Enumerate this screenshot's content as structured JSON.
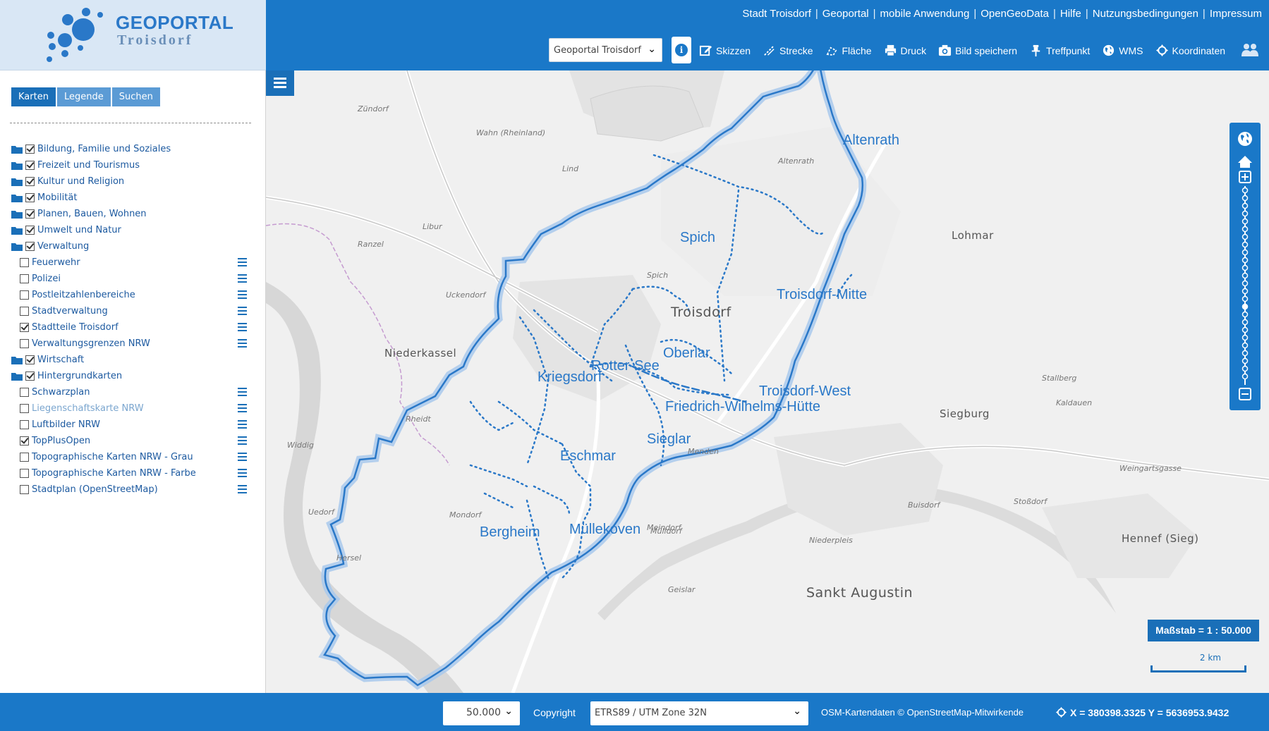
{
  "logo": {
    "title": "GEOPORTAL",
    "subtitle": "Troisdorf"
  },
  "top_links": [
    "Stadt Troisdorf",
    "Geoportal",
    "mobile Anwendung",
    "OpenGeoData",
    "Hilfe",
    "Nutzungsbedingungen",
    "Impressum"
  ],
  "portal_select": {
    "value": "Geoportal Troisdorf"
  },
  "tools": [
    {
      "label": "Skizzen",
      "icon": "pencil-icon"
    },
    {
      "label": "Strecke",
      "icon": "ruler-icon"
    },
    {
      "label": "Fläche",
      "icon": "area-icon"
    },
    {
      "label": "Druck",
      "icon": "print-icon"
    },
    {
      "label": "Bild speichern",
      "icon": "camera-icon"
    },
    {
      "label": "Treffpunkt",
      "icon": "pin-icon"
    },
    {
      "label": "WMS",
      "icon": "globe-icon"
    },
    {
      "label": "Koordinaten",
      "icon": "crosshair-icon"
    }
  ],
  "sidebar": {
    "tabs": [
      "Karten",
      "Legende",
      "Suchen"
    ],
    "active_tab": "Karten",
    "layers": [
      {
        "label": "Bildung, Familie und Soziales",
        "level": 0,
        "checked": true
      },
      {
        "label": "Freizeit und Tourismus",
        "level": 0,
        "checked": true
      },
      {
        "label": "Kultur und Religion",
        "level": 0,
        "checked": true
      },
      {
        "label": "Mobilität",
        "level": 0,
        "checked": true
      },
      {
        "label": "Planen, Bauen, Wohnen",
        "level": 0,
        "checked": true
      },
      {
        "label": "Umwelt und Natur",
        "level": 0,
        "checked": true
      },
      {
        "label": "Verwaltung",
        "level": 0,
        "checked": true
      },
      {
        "label": "Feuerwehr",
        "level": 1,
        "checked": false
      },
      {
        "label": "Polizei",
        "level": 1,
        "checked": false
      },
      {
        "label": "Postleitzahlenbereiche",
        "level": 1,
        "checked": false
      },
      {
        "label": "Stadtverwaltung",
        "level": 1,
        "checked": false
      },
      {
        "label": "Stadtteile Troisdorf",
        "level": 1,
        "checked": true
      },
      {
        "label": "Verwaltungsgrenzen NRW",
        "level": 1,
        "checked": false
      },
      {
        "label": "Wirtschaft",
        "level": 0,
        "checked": true
      },
      {
        "label": "Hintergrundkarten",
        "level": 0,
        "checked": true
      },
      {
        "label": "Schwarzplan",
        "level": 1,
        "checked": false
      },
      {
        "label": "Liegenschaftskarte NRW",
        "level": 1,
        "checked": false,
        "dim": true
      },
      {
        "label": "Luftbilder NRW",
        "level": 1,
        "checked": false
      },
      {
        "label": "TopPlusOpen",
        "level": 1,
        "checked": true
      },
      {
        "label": "Topographische Karten NRW - Grau",
        "level": 1,
        "checked": false
      },
      {
        "label": "Topographische Karten NRW - Farbe",
        "level": 1,
        "checked": false
      },
      {
        "label": "Stadtplan (OpenStreetMap)",
        "level": 1,
        "checked": false
      }
    ]
  },
  "map": {
    "district_labels": [
      "Altenrath",
      "Spich",
      "Troisdorf-Mitte",
      "Oberlar",
      "Rotter-See",
      "Kriegsdorf",
      "Troisdorf-West",
      "Friedrich-Wilhelms-Hütte",
      "Sieglar",
      "Eschmar",
      "Bergheim",
      "Müllekoven"
    ],
    "place_labels": [
      "Troisdorf",
      "Niederkassel",
      "Lohmar",
      "Siegburg",
      "Sankt Augustin",
      "Hennef (Sieg)"
    ],
    "small_labels": [
      "Zündorf",
      "Wahn (Rheinland)",
      "Lind",
      "Libur",
      "Ranzel",
      "Uckendorf",
      "Rheidt",
      "Mondorf",
      "Menden",
      "Mülldorf",
      "Stallberg",
      "Kaldauen",
      "Hersel",
      "Widdig",
      "Uedorf",
      "Stoßdorf",
      "Buisdorf",
      "Niederpleis",
      "Geislar",
      "Weingartsgasse",
      "Meindorf",
      "Altenrath",
      "Spich"
    ],
    "scale_text": "Maßstab = 1 : 50.000",
    "scalebar_label": "2 km",
    "boundary_color": "#2a78c8"
  },
  "footer": {
    "scale_value": "50.000",
    "copyright_label": "Copyright",
    "crs_value": "ETRS89 / UTM Zone 32N",
    "attribution": "OSM-Kartendaten © OpenStreetMap-Mitwirkende",
    "coords": "X = 380398.3325 Y = 5636953.9432"
  }
}
